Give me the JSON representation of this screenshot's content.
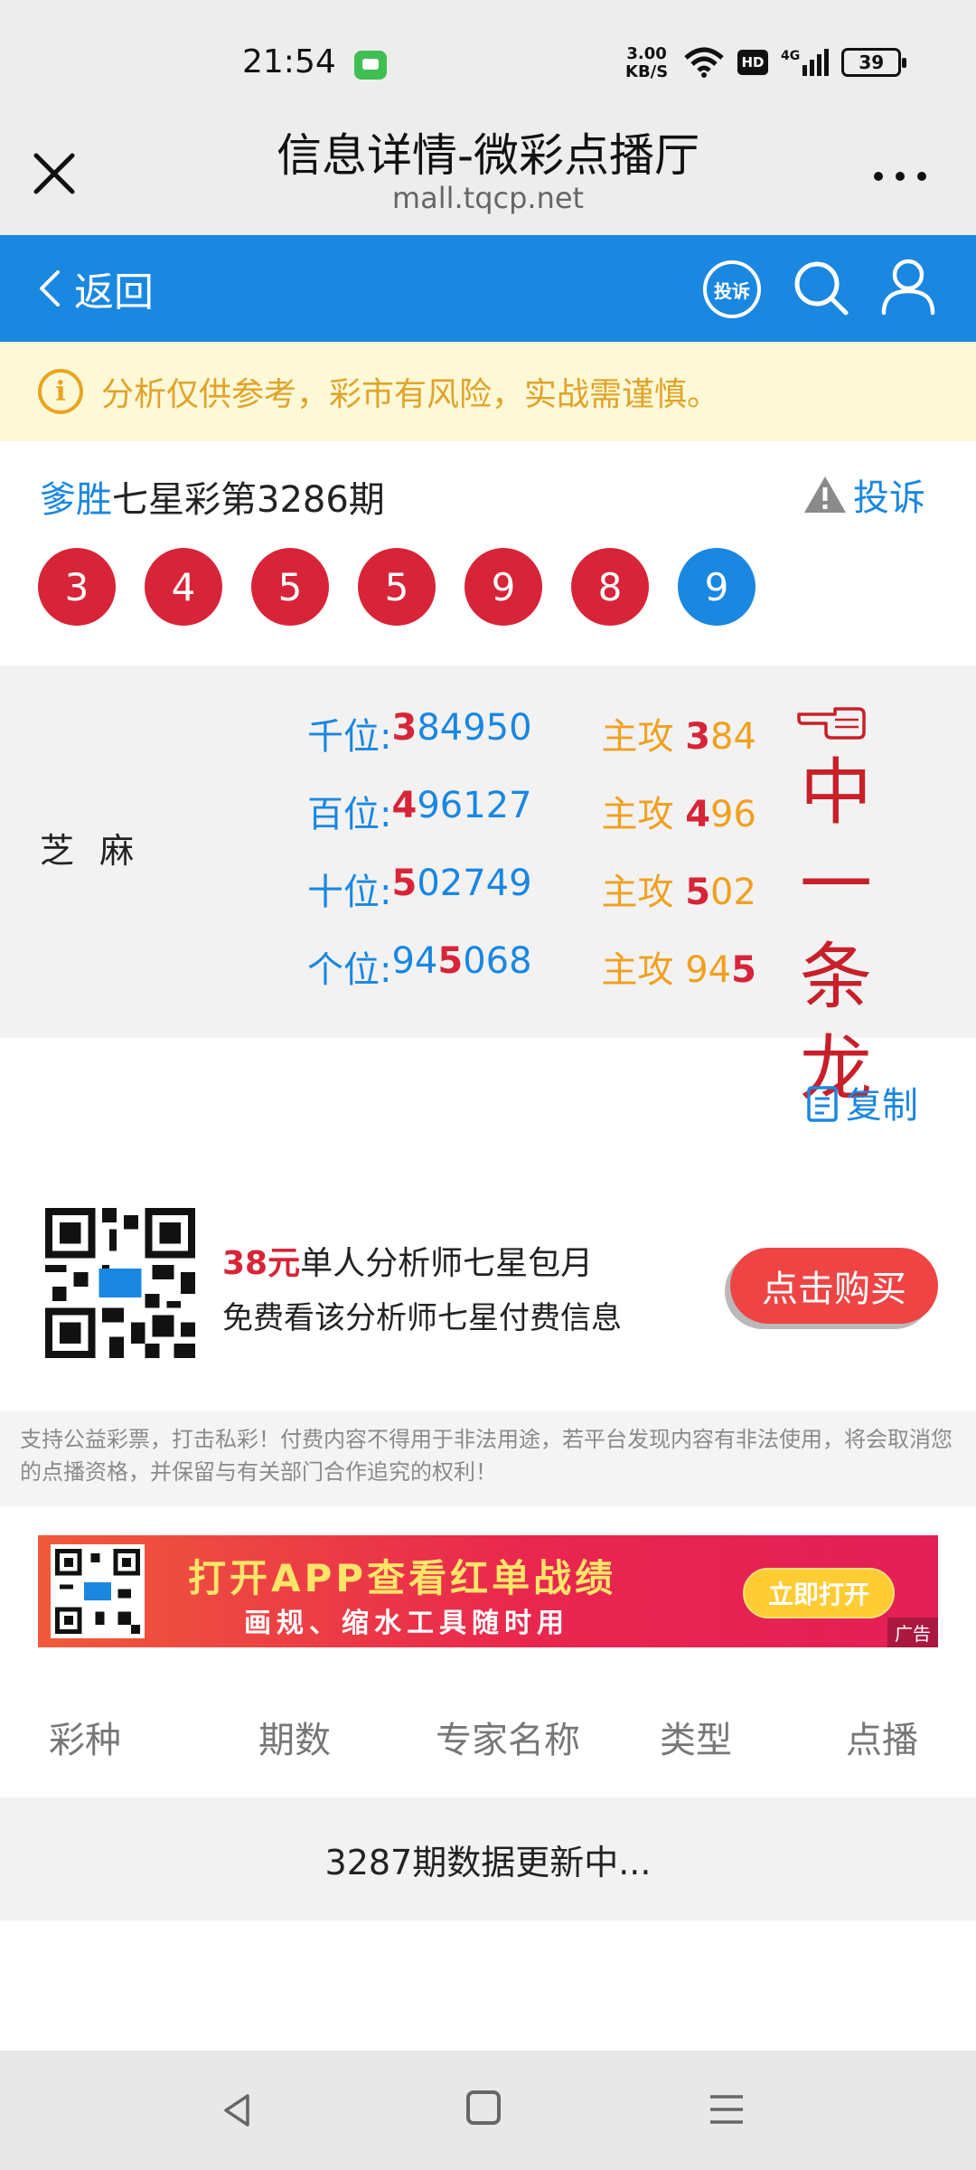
{
  "status_bar": {
    "time": "21:54",
    "net_speed_value": "3.00",
    "net_speed_unit": "KB/S",
    "hd": "HD",
    "network": "4G",
    "battery": "39"
  },
  "title_bar": {
    "title": "信息详情-微彩点播厅",
    "url": "mall.tqcp.net"
  },
  "nav": {
    "back_label": "返回",
    "complain_icon_label": "投诉"
  },
  "notice": {
    "text": "分析仅供参考，彩市有风险，实战需谨慎。"
  },
  "issue": {
    "author": "爹胜",
    "title": "七星彩第3286期",
    "report_label": "投诉"
  },
  "balls": [
    "3",
    "4",
    "5",
    "5",
    "9",
    "8",
    "9"
  ],
  "analysis": {
    "analyst": "芝 麻",
    "rows": [
      {
        "label": "千位:",
        "hit": "3",
        "rest": "84950",
        "attack_label": "主攻",
        "attack_hit": "3",
        "attack_rest": "84"
      },
      {
        "label": "百位:",
        "hit": "4",
        "rest": "96127",
        "attack_label": "主攻",
        "attack_hit": "4",
        "attack_rest": "96"
      },
      {
        "label": "十位:",
        "hit": "5",
        "rest": "02749",
        "attack_label": "主攻",
        "attack_hit": "5",
        "attack_rest": "02"
      },
      {
        "label": "个位:",
        "pre": "94",
        "hit": "5",
        "post": "068",
        "attack_label": "主攻",
        "attack_pre": "94",
        "attack_hit": "5"
      }
    ],
    "overlay_text": [
      "中",
      "一",
      "条",
      "龙"
    ]
  },
  "copy_label": "复制",
  "promo": {
    "price": "38元",
    "title": "单人分析师七星包月",
    "subtitle": "免费看该分析师七星付费信息",
    "buy_label": "点击购买"
  },
  "disclaimer": "支持公益彩票，打击私彩！付费内容不得用于非法用途，若平台发现内容有非法使用，将会取消您的点播资格，并保留与有关部门合作追究的权利！",
  "banner": {
    "main": "打开APP查看红单战绩",
    "sub": "画规、缩水工具随时用",
    "button": "立即打开",
    "ad_tag": "广告"
  },
  "table": {
    "headers": [
      "彩种",
      "期数",
      "专家名称",
      "类型",
      "点播"
    ],
    "empty_text": "3287期数据更新中..."
  },
  "colors": {
    "brand_blue": "#1a87e0",
    "ball_red": "#d82438",
    "attack_orange": "#f0a020",
    "buy_red": "#ef4444"
  }
}
